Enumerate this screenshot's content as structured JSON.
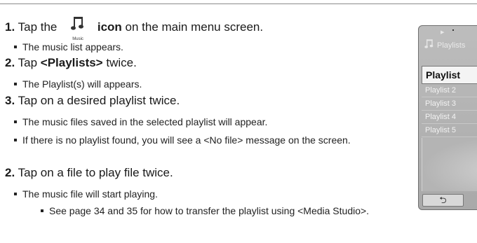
{
  "steps": [
    {
      "num": "1.",
      "text_before": "Tap the",
      "bold": "icon",
      "text_after": "on the main menu screen."
    },
    {
      "num": "2.",
      "text_before": "Tap",
      "bold": "<Playlists>",
      "text_after": "twice."
    },
    {
      "num": "3.",
      "text": "Tap on a desired playlist twice."
    },
    {
      "num": "2.",
      "text": "Tap on a file to play file twice."
    }
  ],
  "bullets": {
    "s1": "The music list appears.",
    "s2": "The Playlist(s) will appears.",
    "s3a": "The music files saved in the selected playlist will appear.",
    "s3b": "If there is no playlist found, you will see a <No file> message on the screen.",
    "s4": "The music file will start playing.",
    "s4sub": "See page 34 and 35 for how to transfer the playlist using <Media Studio>."
  },
  "music_icon": {
    "name": "music-note-icon",
    "caption": "Music"
  },
  "device": {
    "title": "Playlists",
    "items": [
      "Playlist",
      "Playlist 2",
      "Playlist 3",
      "Playlist 4",
      "Playlist 5"
    ],
    "back_icon": "back-arrow-icon",
    "back_glyph": "⮌"
  },
  "colors": {
    "text": "#1a1a1a",
    "device_bg": "#b3b3b3",
    "selected_bg": "#f4f4f4"
  }
}
